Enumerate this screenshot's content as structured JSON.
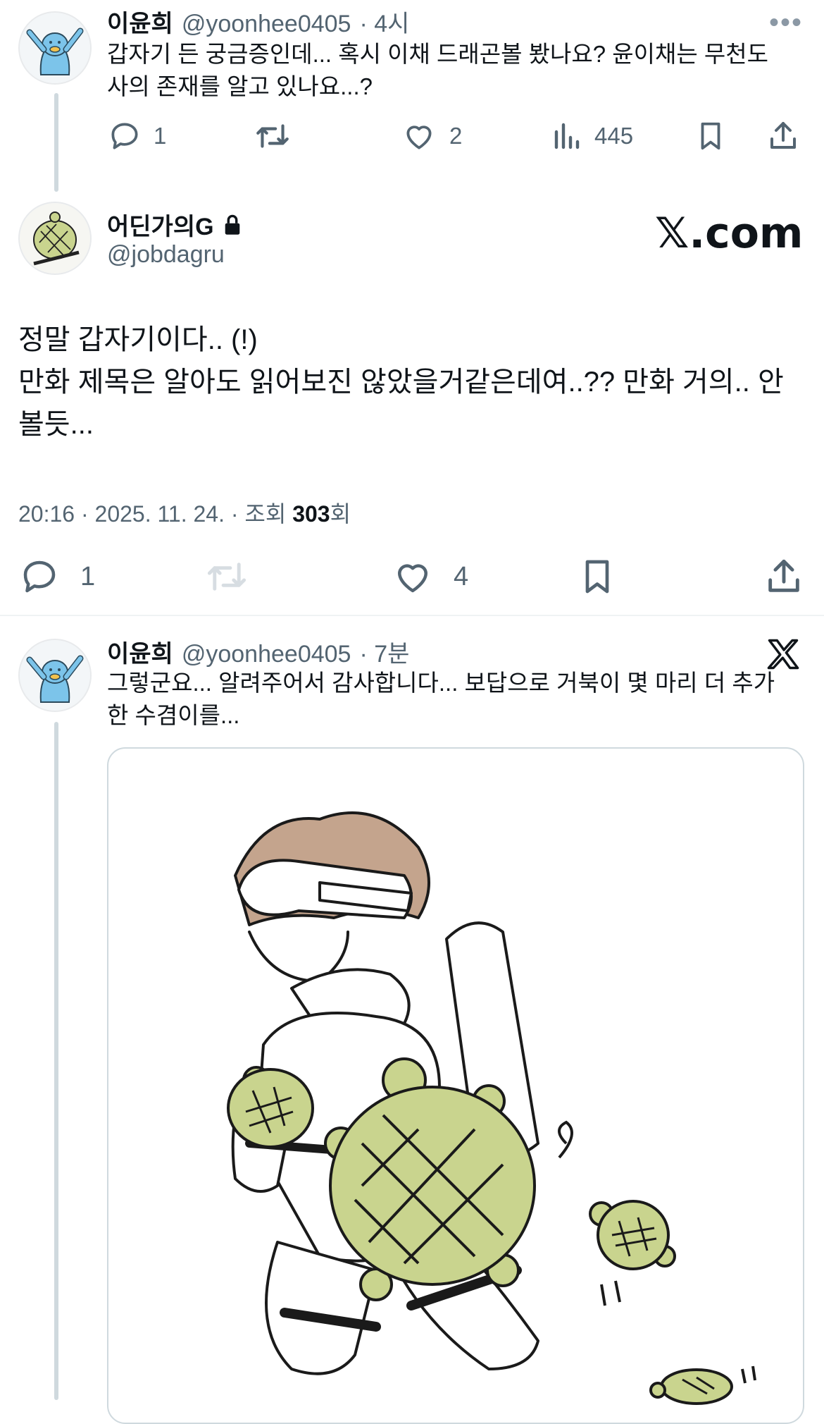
{
  "reply1": {
    "name": "이윤희",
    "handle": "@yoonhee0405",
    "time": "· 4시",
    "text_line1": "갑자기 든 궁금증인데... 혹시 이채 드래곤볼 봤나요? 윤이채는 무천도",
    "text_line2": "사의 존재를 알고 있나요...?",
    "replies": "1",
    "likes": "2",
    "views": "445",
    "more": "•••"
  },
  "main": {
    "name": "어딘가의G",
    "handle": "@jobdagru",
    "watermark": "𝕏.com",
    "line1": "정말 갑자기이다.. (!)",
    "line2": "만화 제목은 알아도 읽어보진 않았을거같은데여..?? 만화 거의.. 안",
    "line3": "볼듯...",
    "meta_prefix": "20:16 · 2025. 11. 24. · 조회 ",
    "meta_views": "303",
    "meta_suffix": "회",
    "replies": "1",
    "likes": "4"
  },
  "reply2": {
    "name": "이윤희",
    "handle": "@yoonhee0405",
    "time": "· 7분",
    "text_line1": "그렇군요... 알려주어서 감사합니다... 보답으로 거북이 몇 마리 더 추가",
    "text_line2": "한 수겸이를..."
  },
  "colors": {
    "text": "#0f1419",
    "muted": "#536471",
    "line": "#cfd9de",
    "turtle": "#c9d48e"
  },
  "icons": [
    "reply-icon",
    "retweet-icon",
    "like-icon",
    "views-icon",
    "bookmark-icon",
    "share-icon",
    "lock-icon",
    "x-logo-icon"
  ]
}
